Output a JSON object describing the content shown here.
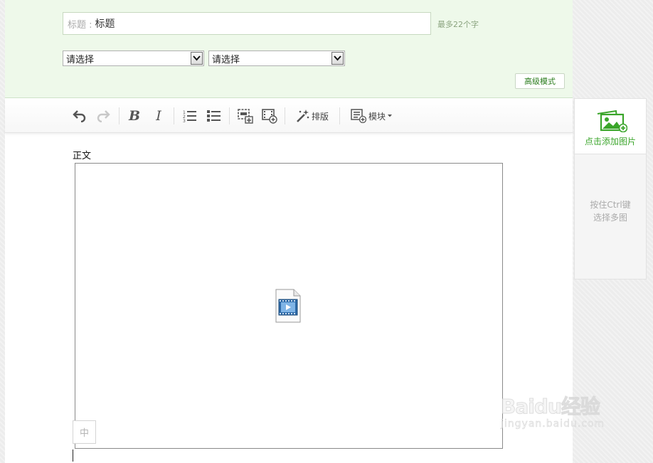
{
  "header": {
    "title_label": "标题 :",
    "title_value": "标题",
    "title_hint": "最多22个字",
    "select_1": "请选择",
    "select_2": "请选择",
    "advanced_mode": "高级模式"
  },
  "toolbar": {
    "layout_label": "排版",
    "module_label": "模块"
  },
  "editor": {
    "body_label": "正文",
    "ime_indicator": "中"
  },
  "side": {
    "add_image_label": "点击添加图片",
    "ctrl_hint_line1": "按住Ctrl键",
    "ctrl_hint_line2": "选择多图"
  },
  "watermark": {
    "main": "Baidu经验",
    "sub": "jingyan.baidu.com"
  },
  "colors": {
    "header_bg": "#eef9ea",
    "accent_green": "#3aa52a",
    "button_green_text": "#2a7c1c"
  }
}
